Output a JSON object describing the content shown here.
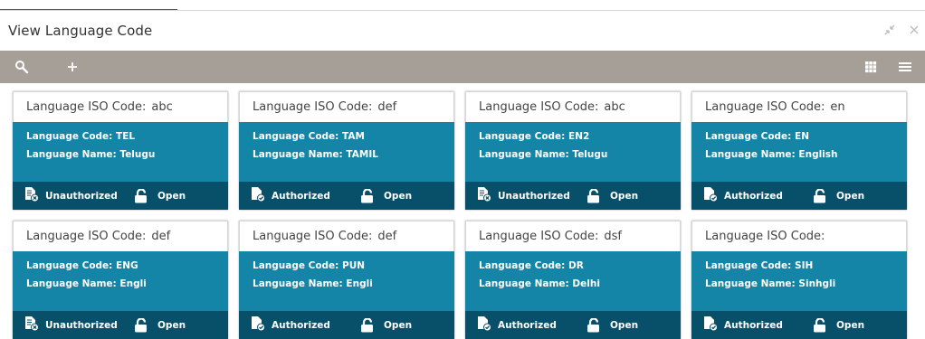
{
  "window": {
    "title": "View Language Code",
    "icons": [
      "minimize-icon",
      "close-icon"
    ]
  },
  "toolbar": {
    "icons": [
      "search-icon",
      "add-icon",
      "grid-view-icon",
      "list-view-icon"
    ]
  },
  "labels": {
    "iso": "Language ISO Code:",
    "code": "Language Code:",
    "name": "Language Name:",
    "open": "Open"
  },
  "cards": [
    {
      "iso": "abc",
      "code": "TEL",
      "name": "Telugu",
      "status": "Unauthorized"
    },
    {
      "iso": "def",
      "code": "TAM",
      "name": "TAMIL",
      "status": "Authorized"
    },
    {
      "iso": "abc",
      "code": "EN2",
      "name": "Telugu",
      "status": "Unauthorized"
    },
    {
      "iso": "en",
      "code": "EN",
      "name": "English",
      "status": "Authorized"
    },
    {
      "iso": "def",
      "code": "ENG",
      "name": "Engli",
      "status": "Unauthorized"
    },
    {
      "iso": "def",
      "code": "PUN",
      "name": "Engli",
      "status": "Authorized"
    },
    {
      "iso": "dsf",
      "code": "DR",
      "name": "Delhi",
      "status": "Authorized"
    },
    {
      "iso": "",
      "code": "SIH",
      "name": "Sinhgli",
      "status": "Authorized"
    }
  ],
  "colors": {
    "toolbar": "#a59f98",
    "card_body": "#1484a7",
    "card_footer": "#08506a"
  }
}
